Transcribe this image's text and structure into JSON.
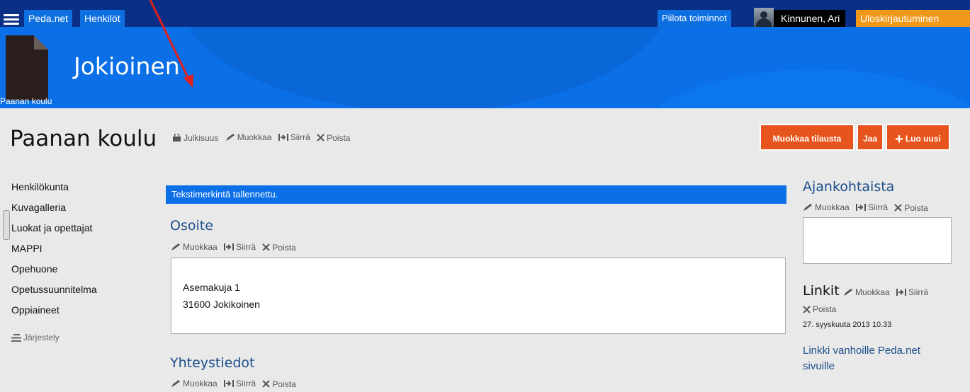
{
  "topbar": {
    "menu_icon": "hamburger-menu-icon",
    "pedanet": "Peda.net",
    "people": "Henkilöt",
    "hide_tools": "Piilota toiminnot",
    "user": "Kinnunen, Ari",
    "logout": "Uloskirjautuminen"
  },
  "banner": {
    "title": "Jokioinen",
    "subtitle": "Paanan koulu",
    "icon": "document-icon"
  },
  "header": {
    "title": "Paanan koulu",
    "actions": {
      "privacy": "Julkisuus",
      "edit": "Muokkaa",
      "move": "Siirrä",
      "delete": "Poista"
    },
    "buttons": {
      "edit_order": "Muokkaa tilausta",
      "share": "Jaa",
      "create_new": "Luo uusi"
    }
  },
  "sidebar": {
    "items": [
      {
        "label": "Henkilökunta"
      },
      {
        "label": "Kuvagalleria"
      },
      {
        "label": "Luokat ja opettajat"
      },
      {
        "label": "MAPPI"
      },
      {
        "label": "Opehuone"
      },
      {
        "label": "Opetussuunnitelma"
      },
      {
        "label": "Oppiaineet"
      }
    ],
    "arrange": "Järjestely"
  },
  "main": {
    "notice": "Tekstimerkintä tallennettu.",
    "address": {
      "title": "Osoite",
      "line1": "Asemakuja 1",
      "line2": "31600 Jokikoinen"
    },
    "contacts": {
      "title": "Yhteystiedot"
    },
    "edit": "Muokkaa",
    "move": "Siirrä",
    "delete": "Poista"
  },
  "right": {
    "news": {
      "title": "Ajankohtaista"
    },
    "links": {
      "title": "Linkit",
      "date": "27. syyskuuta 2013 10.33",
      "link": "Linkki vanhoille Peda.net sivuille"
    },
    "edit": "Muokkaa",
    "move": "Siirrä",
    "delete": "Poista"
  },
  "colors": {
    "topbar": "#0a2f86",
    "banner": "#0b6fe8",
    "accent_button": "#e8541d",
    "logout": "#f09819",
    "link": "#1d4f8b",
    "annotation_arrow": "#e0201b"
  }
}
